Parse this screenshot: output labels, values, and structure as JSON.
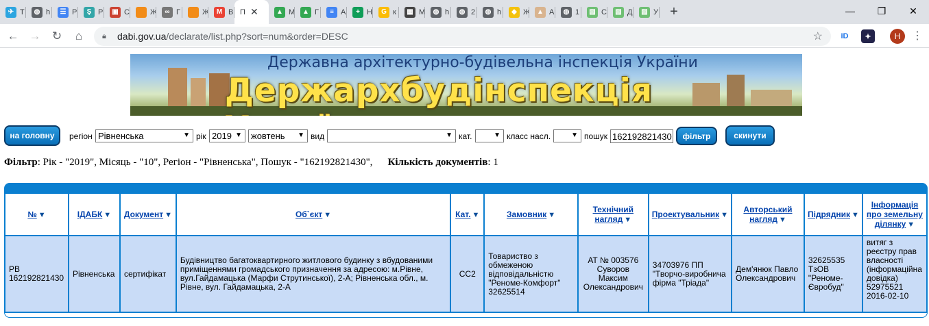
{
  "browser": {
    "tabs": [
      {
        "icon": "telegram-icon",
        "color": "#2ca5e0",
        "glyph": "✈",
        "title": "Т"
      },
      {
        "icon": "globe-icon",
        "color": "#5f6368",
        "glyph": "◍",
        "title": "h"
      },
      {
        "icon": "google-forms-icon",
        "color": "#4285f4",
        "glyph": "☰",
        "title": "Р"
      },
      {
        "icon": "prozorro-icon",
        "color": "#33a6a8",
        "glyph": "Ş",
        "title": "Р"
      },
      {
        "icon": "image-icon",
        "color": "#cc4433",
        "glyph": "▣",
        "title": "С"
      },
      {
        "icon": "orange-square-icon",
        "color": "#f28c18",
        "glyph": "",
        "title": "Ж"
      },
      {
        "icon": "360-icon",
        "color": "#777777",
        "glyph": "∞",
        "title": "Г"
      },
      {
        "icon": "orange-square-icon",
        "color": "#f28c18",
        "glyph": "",
        "title": "Ж"
      },
      {
        "icon": "gmail-icon",
        "color": "#ea4335",
        "glyph": "M",
        "title": "В"
      },
      {
        "icon": "google-drive-icon",
        "color": "#34a853",
        "glyph": "▲",
        "title": "М"
      },
      {
        "icon": "google-drive-icon",
        "color": "#34a853",
        "glyph": "▲",
        "title": "Г"
      },
      {
        "icon": "google-docs-icon",
        "color": "#4285f4",
        "glyph": "≡",
        "title": "А"
      },
      {
        "icon": "google-sheets-add-icon",
        "color": "#0f9d58",
        "glyph": "+",
        "title": "Н"
      },
      {
        "icon": "google-icon",
        "color": "#fbbc05",
        "glyph": "G",
        "title": "к"
      },
      {
        "icon": "qr-icon",
        "color": "#444444",
        "glyph": "▦",
        "title": "М"
      },
      {
        "icon": "globe-icon",
        "color": "#5f6368",
        "glyph": "◍",
        "title": "h"
      },
      {
        "icon": "globe-icon",
        "color": "#5f6368",
        "glyph": "◍",
        "title": "2"
      },
      {
        "icon": "globe-icon",
        "color": "#5f6368",
        "glyph": "◍",
        "title": "h"
      },
      {
        "icon": "yellow-diamond-icon",
        "color": "#f4c20d",
        "glyph": "◆",
        "title": "Ж"
      },
      {
        "icon": "tent-icon",
        "color": "#d9b48f",
        "glyph": "▲",
        "title": "А"
      },
      {
        "icon": "globe-icon",
        "color": "#5f6368",
        "glyph": "◍",
        "title": "1"
      },
      {
        "icon": "sheet-icon",
        "color": "#6fbf73",
        "glyph": "▧",
        "title": "С"
      },
      {
        "icon": "sheet-icon",
        "color": "#6fbf73",
        "glyph": "▧",
        "title": "Д"
      },
      {
        "icon": "sheet-icon",
        "color": "#6fbf73",
        "glyph": "▧",
        "title": "У"
      }
    ],
    "active_tab": {
      "title": "П",
      "icon": "document-icon"
    },
    "url_host": "dabi.gov.ua",
    "url_path": "/declarate/list.php?sort=num&order=DESC",
    "avatar_letter": "H"
  },
  "banner": {
    "subtitle": "Державна архітектурно-будівельна інспекція України",
    "title": "Держархбудінспекція України"
  },
  "filters": {
    "home_button": "на головну",
    "region_label": "регіон",
    "region_value": "Рівненська",
    "year_label": "рік",
    "year_value": "2019",
    "month_value": "жовтень",
    "type_label": "вид",
    "type_value": "",
    "cat_label": "кат.",
    "cat_value": "",
    "class_label": "класс насл.",
    "class_value": "",
    "search_label": "пошук",
    "search_value": "162192821430",
    "filter_button": "фільтр",
    "reset_button": "скинути"
  },
  "summary": {
    "filter_label": "Фільтр",
    "filter_text": ": Рік - \"2019\", Місяць - \"10\", Регіон - \"Рівненська\", Пошук - \"162192821430\",",
    "count_label": "Кількість документів",
    "count_value": ": 1"
  },
  "table": {
    "headers": [
      "№",
      "ІДАБК",
      "Документ",
      "Об`єкт",
      "Кат.",
      "Замовник",
      "Технічний нагляд",
      "Проектувальник",
      "Авторський нагляд",
      "Підрядник",
      "Інформація про земельну ділянку"
    ],
    "rows": [
      [
        "РВ 162192821430",
        "Рівненська",
        "сертифікат",
        "Будівництво багатоквартирного житлового будинку з вбудованими приміщеннями громадського призначення за адресою: м.Рівне, вул.Гайдамацька (Марфи Струтинської), 2-А; Рівненська обл., м. Рівне, вул. Гайдамацька, 2-А",
        "СС2",
        "Товариство з обмеженою відповідальністю \"Реноме-Комфорт\" 32625514",
        "АТ № 003576 Суворов Максим Олександрович",
        "34703976 ПП \"Творчо-виробнича фірма \"Тріада\"",
        "Дем'янюк Павло Олександрович",
        "32625535 ТзОВ \"Реноме-Євробуд\"",
        "витяг з реєстру прав власності (інформаційна довідка) 52975521 2016-02-10"
      ]
    ]
  }
}
